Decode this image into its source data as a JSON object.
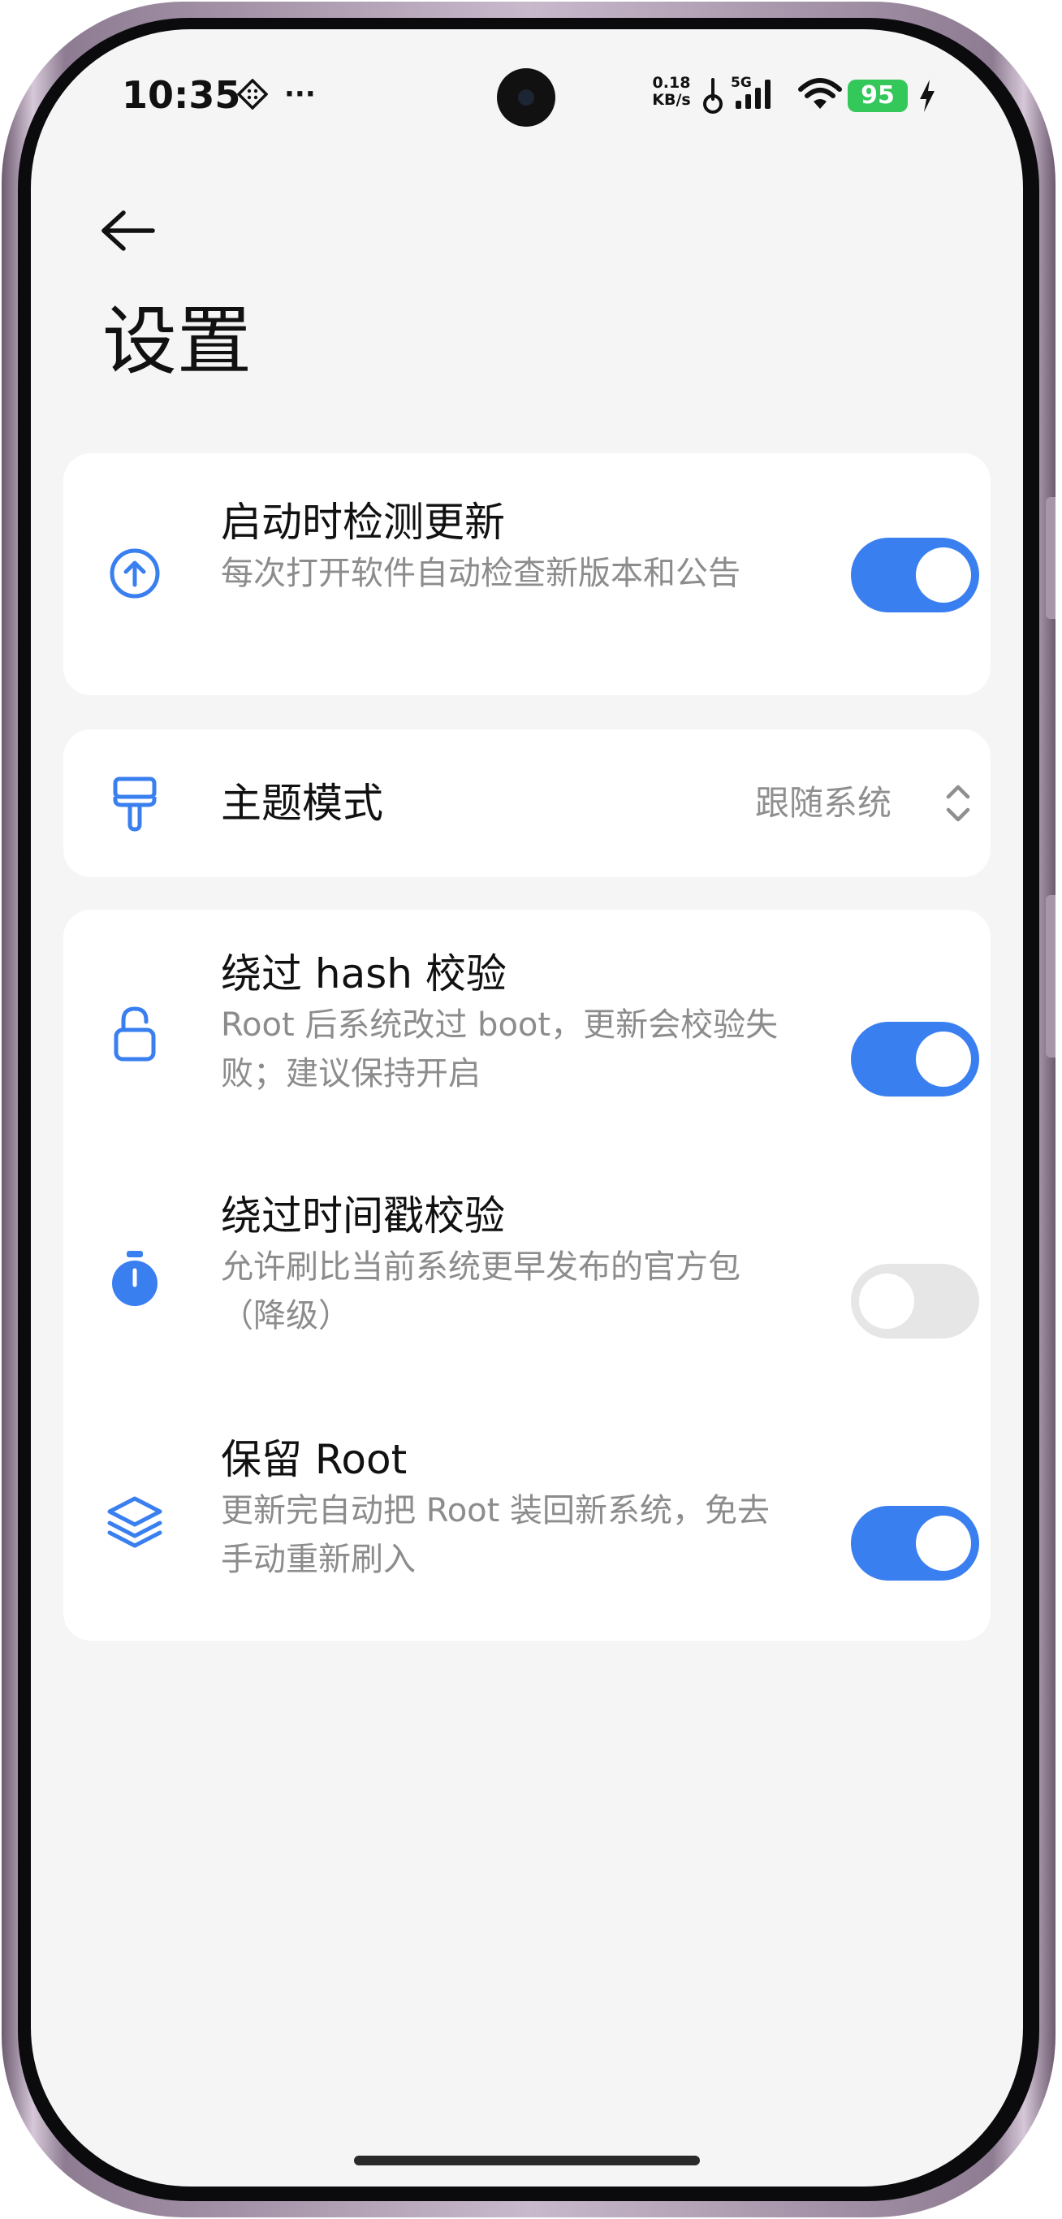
{
  "status_bar": {
    "time": "10:35",
    "more_glyph": "···",
    "net_speed_value": "0.18",
    "net_speed_unit": "KB/s",
    "network_type": "5G",
    "battery_level": "95",
    "icons": [
      "app-notification-icon",
      "more-dots-icon",
      "hotspot-icon",
      "cellular-signal-icon",
      "wifi-icon",
      "charging-icon"
    ]
  },
  "header": {
    "title": "设置",
    "back_icon": "back-arrow-icon"
  },
  "cards": [
    {
      "rows": [
        {
          "icon": "upload-arrow-circle-icon",
          "title": "启动时检测更新",
          "description": "每次打开软件自动检查新版本和公告",
          "control": "toggle",
          "enabled": true
        }
      ]
    },
    {
      "rows": [
        {
          "icon": "paint-brush-icon",
          "title": "主题模式",
          "control": "select",
          "value": "跟随系统"
        }
      ]
    },
    {
      "rows": [
        {
          "icon": "unlocked-padlock-icon",
          "title": "绕过 hash 校验",
          "description": "Root 后系统改过 boot，更新会校验失败；建议保持开启",
          "control": "toggle",
          "enabled": true
        },
        {
          "icon": "stopwatch-icon",
          "title": "绕过时间戳校验",
          "description": "允许刷比当前系统更早发布的官方包（降级）",
          "control": "toggle",
          "enabled": false
        },
        {
          "icon": "layers-icon",
          "title": "保留 Root",
          "description": "更新完自动把 Root 装回新系统，免去手动重新刷入",
          "control": "toggle",
          "enabled": true
        }
      ]
    }
  ],
  "colors": {
    "accent": "#3a7ff0",
    "toggle_off": "#e6e6e6",
    "background": "#f5f5f5",
    "card": "#ffffff",
    "battery": "#34c759"
  }
}
